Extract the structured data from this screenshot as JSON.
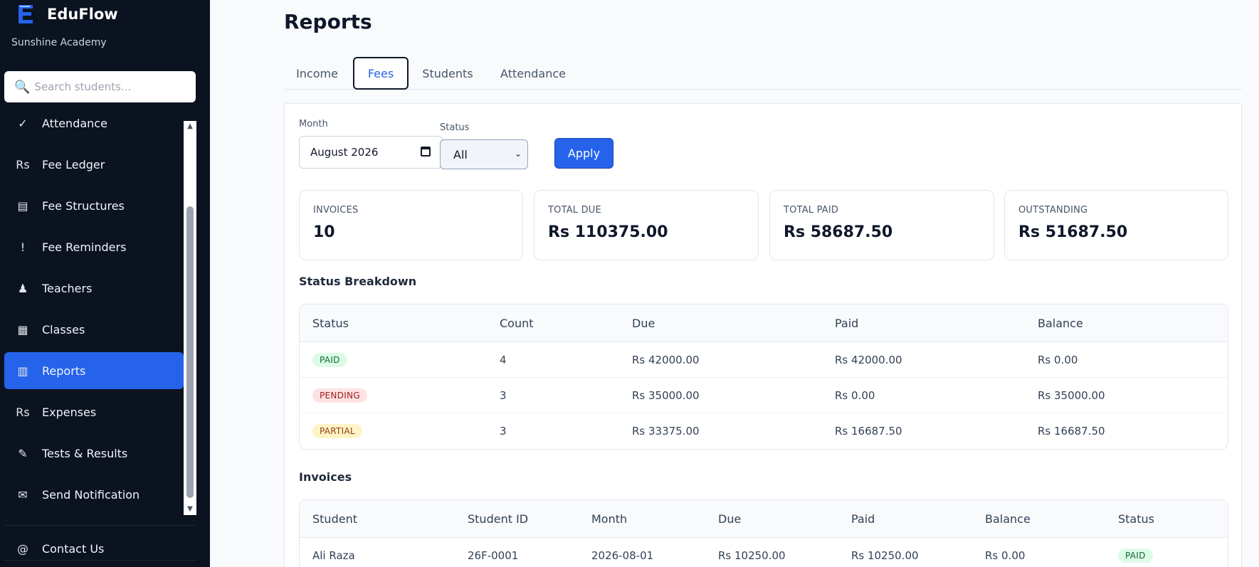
{
  "brand": {
    "name": "EduFlow",
    "subtitle": "Sunshine Academy"
  },
  "search": {
    "placeholder": "Search students..."
  },
  "sidebar": {
    "items": [
      {
        "icon": "check-icon",
        "glyph": "✓",
        "label": "Attendance",
        "active": false
      },
      {
        "icon": "rupee-icon",
        "glyph": "Rs",
        "label": "Fee Ledger",
        "active": false
      },
      {
        "icon": "list-icon",
        "glyph": "▤",
        "label": "Fee Structures",
        "active": false
      },
      {
        "icon": "exclamation-icon",
        "glyph": "!",
        "label": "Fee Reminders",
        "active": false
      },
      {
        "icon": "teacher-icon",
        "glyph": "♟",
        "label": "Teachers",
        "active": false
      },
      {
        "icon": "grid-icon",
        "glyph": "▦",
        "label": "Classes",
        "active": false
      },
      {
        "icon": "chart-icon",
        "glyph": "▥",
        "label": "Reports",
        "active": true
      },
      {
        "icon": "rupee-icon",
        "glyph": "Rs",
        "label": "Expenses",
        "active": false
      },
      {
        "icon": "pencil-icon",
        "glyph": "✎",
        "label": "Tests & Results",
        "active": false
      },
      {
        "icon": "envelope-icon",
        "glyph": "✉",
        "label": "Send Notification",
        "active": false
      }
    ],
    "contact": {
      "icon": "at-icon",
      "glyph": "@",
      "label": "Contact Us"
    }
  },
  "page": {
    "title": "Reports"
  },
  "tabs": [
    {
      "label": "Income",
      "active": false
    },
    {
      "label": "Fees",
      "active": true
    },
    {
      "label": "Students",
      "active": false
    },
    {
      "label": "Attendance",
      "active": false
    }
  ],
  "filters": {
    "month_label": "Month",
    "month_value": "August 2026",
    "status_label": "Status",
    "status_value": "All",
    "apply_label": "Apply"
  },
  "summary": [
    {
      "label": "INVOICES",
      "value": "10"
    },
    {
      "label": "TOTAL DUE",
      "value": "Rs 110375.00"
    },
    {
      "label": "TOTAL PAID",
      "value": "Rs 58687.50"
    },
    {
      "label": "OUTSTANDING",
      "value": "Rs 51687.50"
    }
  ],
  "breakdown": {
    "title": "Status Breakdown",
    "columns": [
      "Status",
      "Count",
      "Due",
      "Paid",
      "Balance"
    ],
    "rows": [
      {
        "status": "PAID",
        "kind": "paid",
        "count": "4",
        "due": "Rs 42000.00",
        "paid": "Rs 42000.00",
        "balance": "Rs 0.00"
      },
      {
        "status": "PENDING",
        "kind": "pending",
        "count": "3",
        "due": "Rs 35000.00",
        "paid": "Rs 0.00",
        "balance": "Rs 35000.00"
      },
      {
        "status": "PARTIAL",
        "kind": "partial",
        "count": "3",
        "due": "Rs 33375.00",
        "paid": "Rs 16687.50",
        "balance": "Rs 16687.50"
      }
    ]
  },
  "invoices": {
    "title": "Invoices",
    "columns": [
      "Student",
      "Student ID",
      "Month",
      "Due",
      "Paid",
      "Balance",
      "Status"
    ],
    "rows": [
      {
        "student": "Ali Raza",
        "student_id": "26F-0001",
        "month": "2026-08-01",
        "due": "Rs 10250.00",
        "paid": "Rs 10250.00",
        "balance": "Rs 0.00",
        "status": "PAID",
        "kind": "paid"
      }
    ]
  },
  "colors": {
    "sidebar_bg": "#0b1220",
    "accent": "#2563eb",
    "paid": "#dcfce7",
    "pending": "#fee2e2",
    "partial": "#fef3c7"
  }
}
